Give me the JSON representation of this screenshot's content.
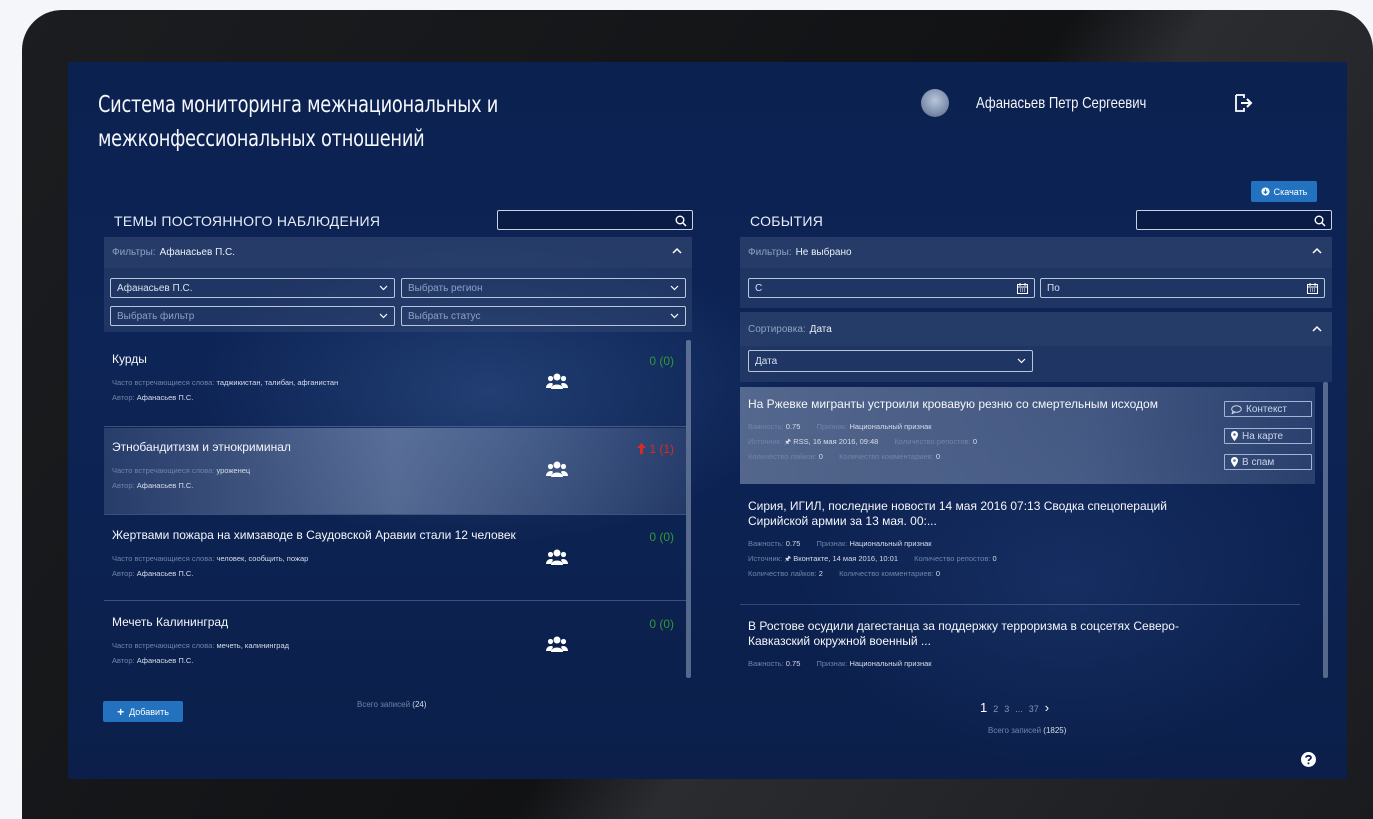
{
  "header": {
    "app_title": "Система мониторинга межнациональных и межконфессиональных отношений",
    "user_name": "Афанасьев Петр Сергеевич"
  },
  "download_label": "Скачать",
  "topics_panel": {
    "title": "ТЕМЫ ПОСТОЯННОГО НАБЛЮДЕНИЯ",
    "search_placeholder": "",
    "filters_label": "Фильтры:",
    "filters_value": "Афанасьев П.С.",
    "selects": {
      "author": "Афанасьев П.С.",
      "region": "Выбрать регион",
      "filter": "Выбрать фильтр",
      "status": "Выбрать статус"
    },
    "words_label": "Часто встречающиеся слова:",
    "author_label": "Автор:",
    "items": [
      {
        "title": "Курды",
        "words": "таджикистан, талибан, афганистан",
        "author": "Афанасьев П.С.",
        "count": "0 (0)",
        "trend": "none"
      },
      {
        "title": "Этнобандитизм и этнокриминал",
        "words": "уроженец",
        "author": "Афанасьев П.С.",
        "count": "1 (1)",
        "trend": "up"
      },
      {
        "title": "Жертвами пожара на химзаводе в Саудовской Аравии стали 12 человек",
        "words": "человек, сообщить, пожар",
        "author": "Афанасьев П.С.",
        "count": "0 (0)",
        "trend": "none"
      },
      {
        "title": "Мечеть Калининград",
        "words": "мечеть, калининград",
        "author": "Афанасьев П.С.",
        "count": "0 (0)",
        "trend": "none"
      }
    ],
    "add_label": "Добавить",
    "total_label": "Всего записей",
    "total_value": "(24)"
  },
  "events_panel": {
    "title": "СОБЫТИЯ",
    "search_placeholder": "",
    "filters_label": "Фильтры:",
    "filters_value": "Не выбрано",
    "date_from": "С",
    "date_to": "По",
    "sort_label": "Сортировка:",
    "sort_value": "Дата",
    "sort_select": "Дата",
    "labels": {
      "importance": "Важность:",
      "sign": "Признак:",
      "source": "Источник:",
      "reposts": "Количество репостов:",
      "likes": "Количество лайков:",
      "comments": "Количество комментариев:"
    },
    "buttons": {
      "context": "Контекст",
      "map": "На карте",
      "spam": "В спам"
    },
    "items": [
      {
        "title": "На Ржевке мигранты устроили кровавую резню со смертельным исходом",
        "importance": "0.75",
        "sign": "Национальный признак",
        "source": "RSS, 16 мая 2016, 09:48",
        "reposts": "0",
        "likes": "0",
        "comments": "0"
      },
      {
        "title": "Сирия, ИГИЛ, последние новости 14 мая 2016 07:13 Сводка спецопераций Сирийской армии за 13 мая. 00:...",
        "importance": "0.75",
        "sign": "Национальный признак",
        "source": "Вконтакте, 14 мая 2016, 10:01",
        "reposts": "0",
        "likes": "2",
        "comments": "0"
      },
      {
        "title": "В Ростове осудили дагестанца за поддержку терроризма в соцсетях Северо-Кавказский окружной военный ...",
        "importance": "0.75",
        "sign": "Национальный признак"
      }
    ],
    "pagination": {
      "current": "1",
      "p2": "2",
      "p3": "3",
      "dots": "...",
      "last": "37",
      "next": "›"
    },
    "total_label": "Всего записей",
    "total_value": "(1825)"
  }
}
